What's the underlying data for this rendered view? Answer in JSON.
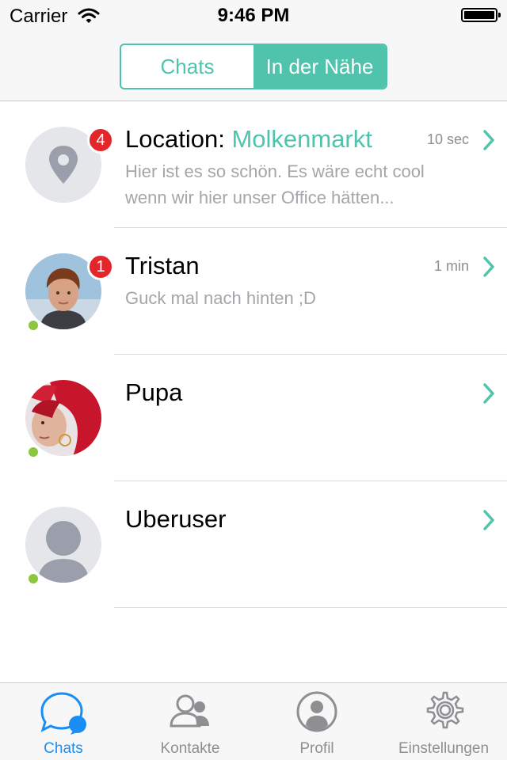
{
  "status_bar": {
    "carrier": "Carrier",
    "time": "9:46 PM"
  },
  "segmented": {
    "items": [
      {
        "label": "Chats"
      },
      {
        "label": "In der Nähe"
      }
    ],
    "selected": "In der Nähe"
  },
  "chats": [
    {
      "title_prefix": "Location: ",
      "title_highlight": "Molkenmarkt",
      "time": "10 sec",
      "badge": "4",
      "preview": "Hier ist es so schön. Es wäre echt cool wenn wir hier unser Office hätten...",
      "avatar": "location-pin-icon",
      "online": false
    },
    {
      "name": "Tristan",
      "time": "1 min",
      "badge": "1",
      "preview": "Guck mal nach hinten ;D",
      "avatar": "photo",
      "online": true
    },
    {
      "name": "Pupa",
      "time": "",
      "badge": "",
      "preview": "",
      "avatar": "photo",
      "online": true
    },
    {
      "name": "Uberuser",
      "time": "",
      "badge": "",
      "preview": "",
      "avatar": "default-person-icon",
      "online": true
    }
  ],
  "tabbar": [
    {
      "label": "Chats",
      "icon": "chat-bubbles-icon",
      "active": true
    },
    {
      "label": "Kontakte",
      "icon": "contacts-icon",
      "active": false
    },
    {
      "label": "Profil",
      "icon": "profile-icon",
      "active": false
    },
    {
      "label": "Einstellungen",
      "icon": "gear-icon",
      "active": false
    }
  ],
  "colors": {
    "accent": "#4fc3ac",
    "badge": "#e3262b",
    "online": "#8dc63f",
    "tab_active": "#1a8ef5",
    "muted": "#a5a5aa"
  }
}
